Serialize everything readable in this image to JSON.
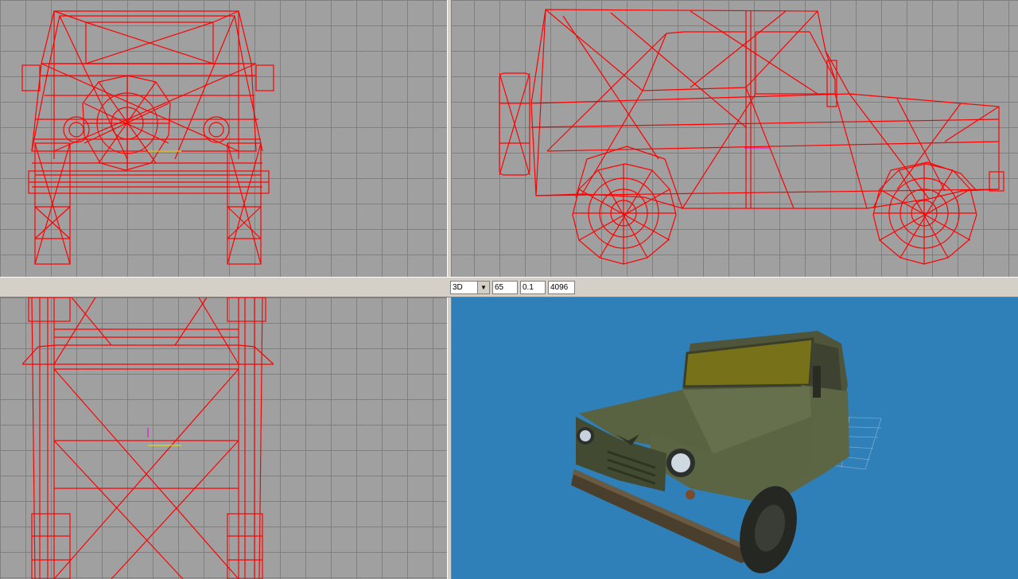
{
  "toolbar": {
    "view_mode": "3D",
    "fov": "65",
    "near_clip": "0.1",
    "far_clip": "4096"
  },
  "icons": {
    "combo_arrow": "chevron-down-icon"
  },
  "colors": {
    "wireframe": "#ff0000",
    "grid_background": "#a0a0a0",
    "grid_lines": "#7f7f7f",
    "viewport_3d_background": "#2f7fb9",
    "vehicle_body": "#5d6644"
  }
}
